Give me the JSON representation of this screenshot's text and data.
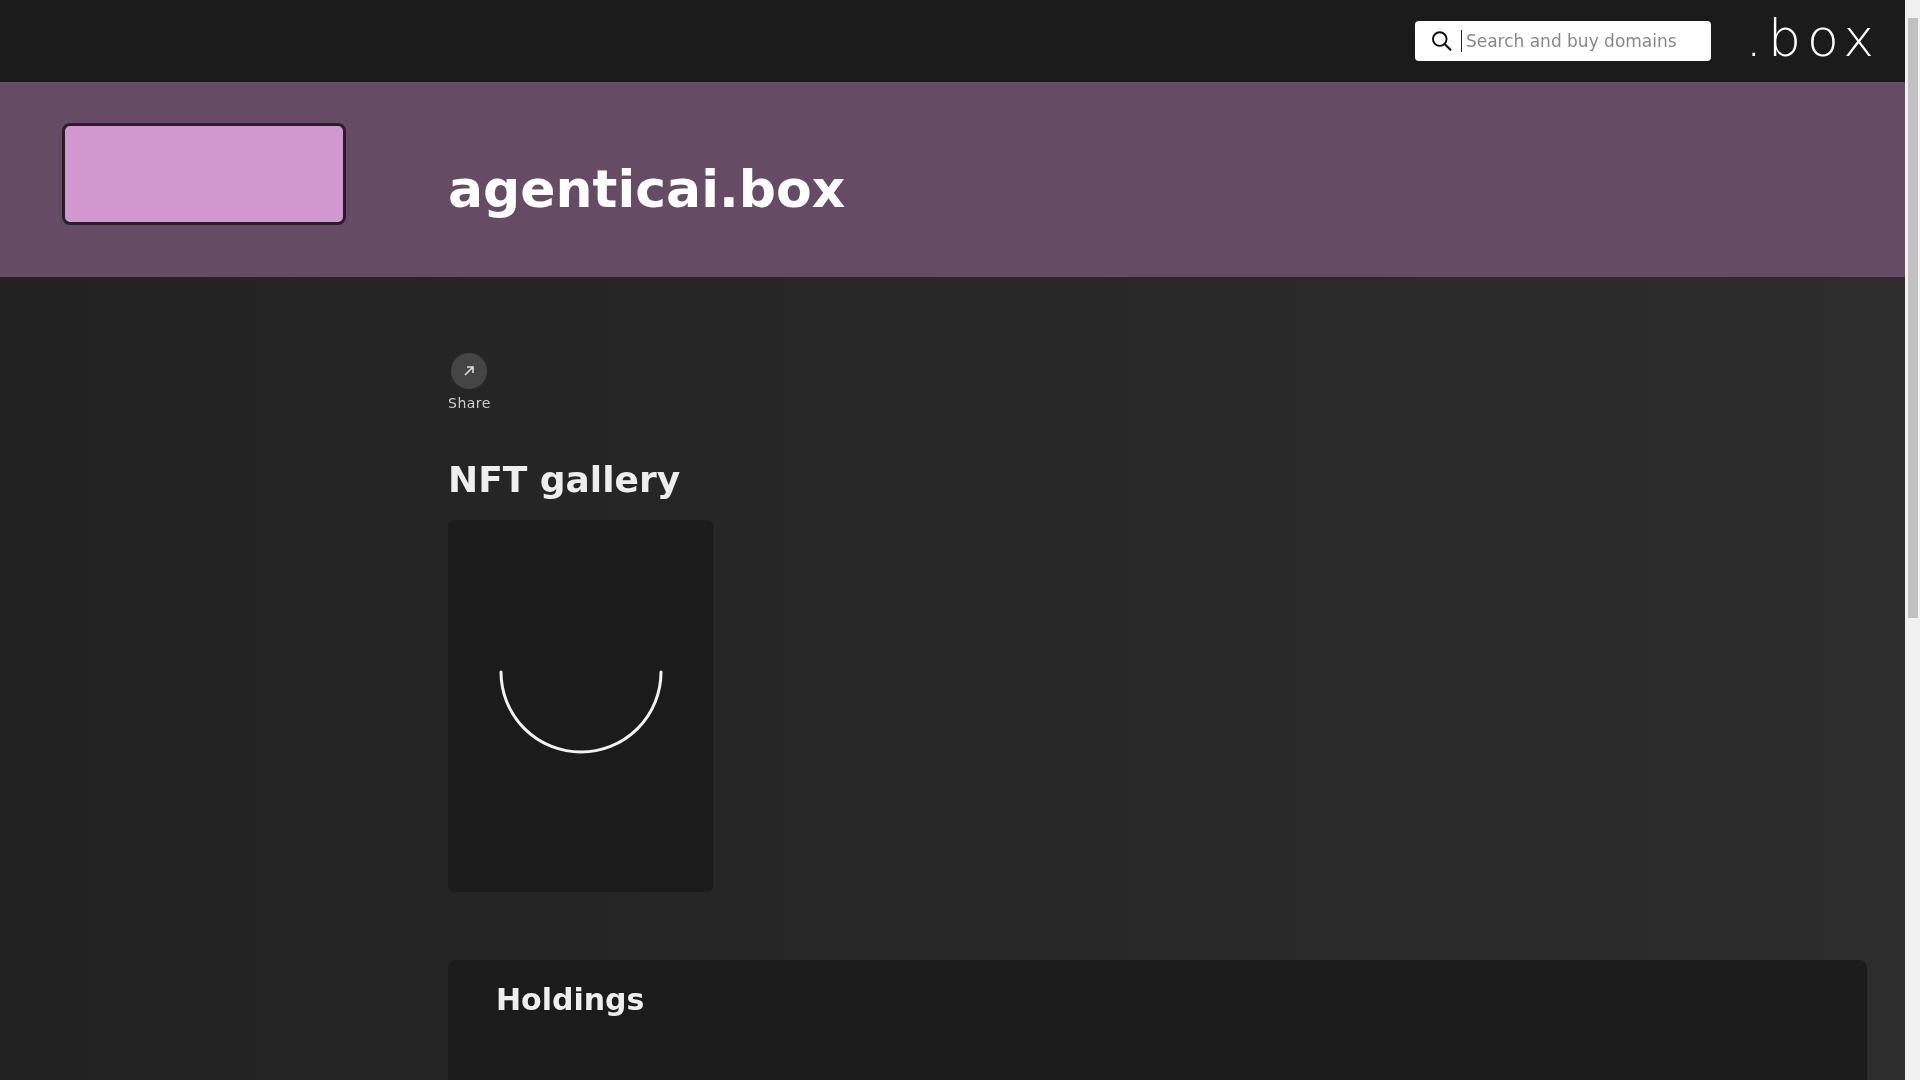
{
  "header": {
    "search": {
      "placeholder": "Search and buy domains"
    },
    "logo": ".box"
  },
  "banner": {
    "title": "agenticai.box"
  },
  "actions": [
    {
      "label": "Share"
    }
  ],
  "gallery": {
    "title": "NFT gallery",
    "items": [
      {
        "kind": "loading"
      }
    ]
  },
  "holdings": {
    "title": "Holdings"
  }
}
